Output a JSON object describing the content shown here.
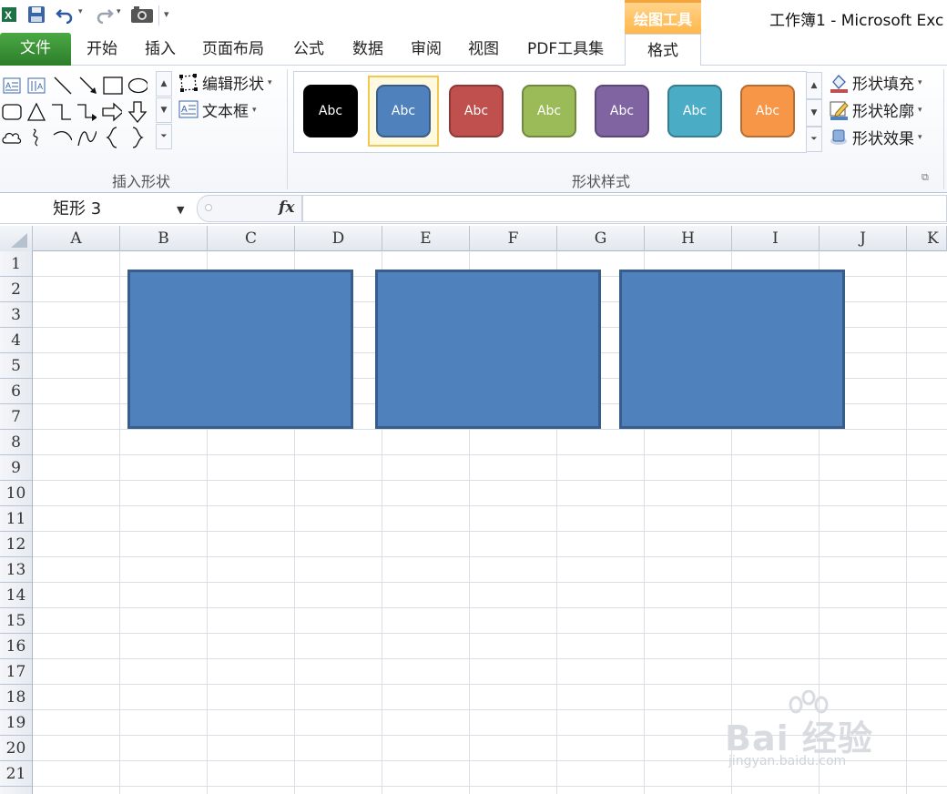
{
  "window": {
    "title": "工作簿1 - Microsoft Exc"
  },
  "ribbon": {
    "file_tab": "文件",
    "tabs": [
      "开始",
      "插入",
      "页面布局",
      "公式",
      "数据",
      "审阅",
      "视图",
      "PDF工具集"
    ],
    "contextual_header": "绘图工具",
    "active_tab": "格式",
    "insert_shapes": {
      "edit_shape": "编辑形状",
      "text_box": "文本框",
      "group_label": "插入形状"
    },
    "shape_styles": {
      "group_label": "形状样式",
      "styles": [
        {
          "label": "Abc",
          "fill": "#000000",
          "border": "#000000"
        },
        {
          "label": "Abc",
          "fill": "#4f81bd",
          "border": "#385d8a",
          "selected": true
        },
        {
          "label": "Abc",
          "fill": "#c0504d",
          "border": "#8c3836"
        },
        {
          "label": "Abc",
          "fill": "#9bbb59",
          "border": "#71893f"
        },
        {
          "label": "Abc",
          "fill": "#8064a2",
          "border": "#5c4776"
        },
        {
          "label": "Abc",
          "fill": "#4bacc6",
          "border": "#357d91"
        },
        {
          "label": "Abc",
          "fill": "#f79646",
          "border": "#b66d31"
        }
      ],
      "fill": "形状填充",
      "outline": "形状轮廓",
      "effects": "形状效果"
    }
  },
  "formula_bar": {
    "name_box": "矩形 3",
    "fx": "fx",
    "formula": ""
  },
  "sheet": {
    "columns": [
      "A",
      "B",
      "C",
      "D",
      "E",
      "F",
      "G",
      "H",
      "I",
      "J",
      "K"
    ],
    "rows": [
      "1",
      "2",
      "3",
      "4",
      "5",
      "6",
      "7",
      "8",
      "9",
      "10",
      "11",
      "12",
      "13",
      "14",
      "15",
      "16",
      "17",
      "18",
      "19",
      "20",
      "21"
    ],
    "shape_color": "#4f81bd",
    "shape_border": "#385d8a"
  },
  "watermark": {
    "brand": "Bai 经验",
    "url": "jingyan.baidu.com"
  }
}
